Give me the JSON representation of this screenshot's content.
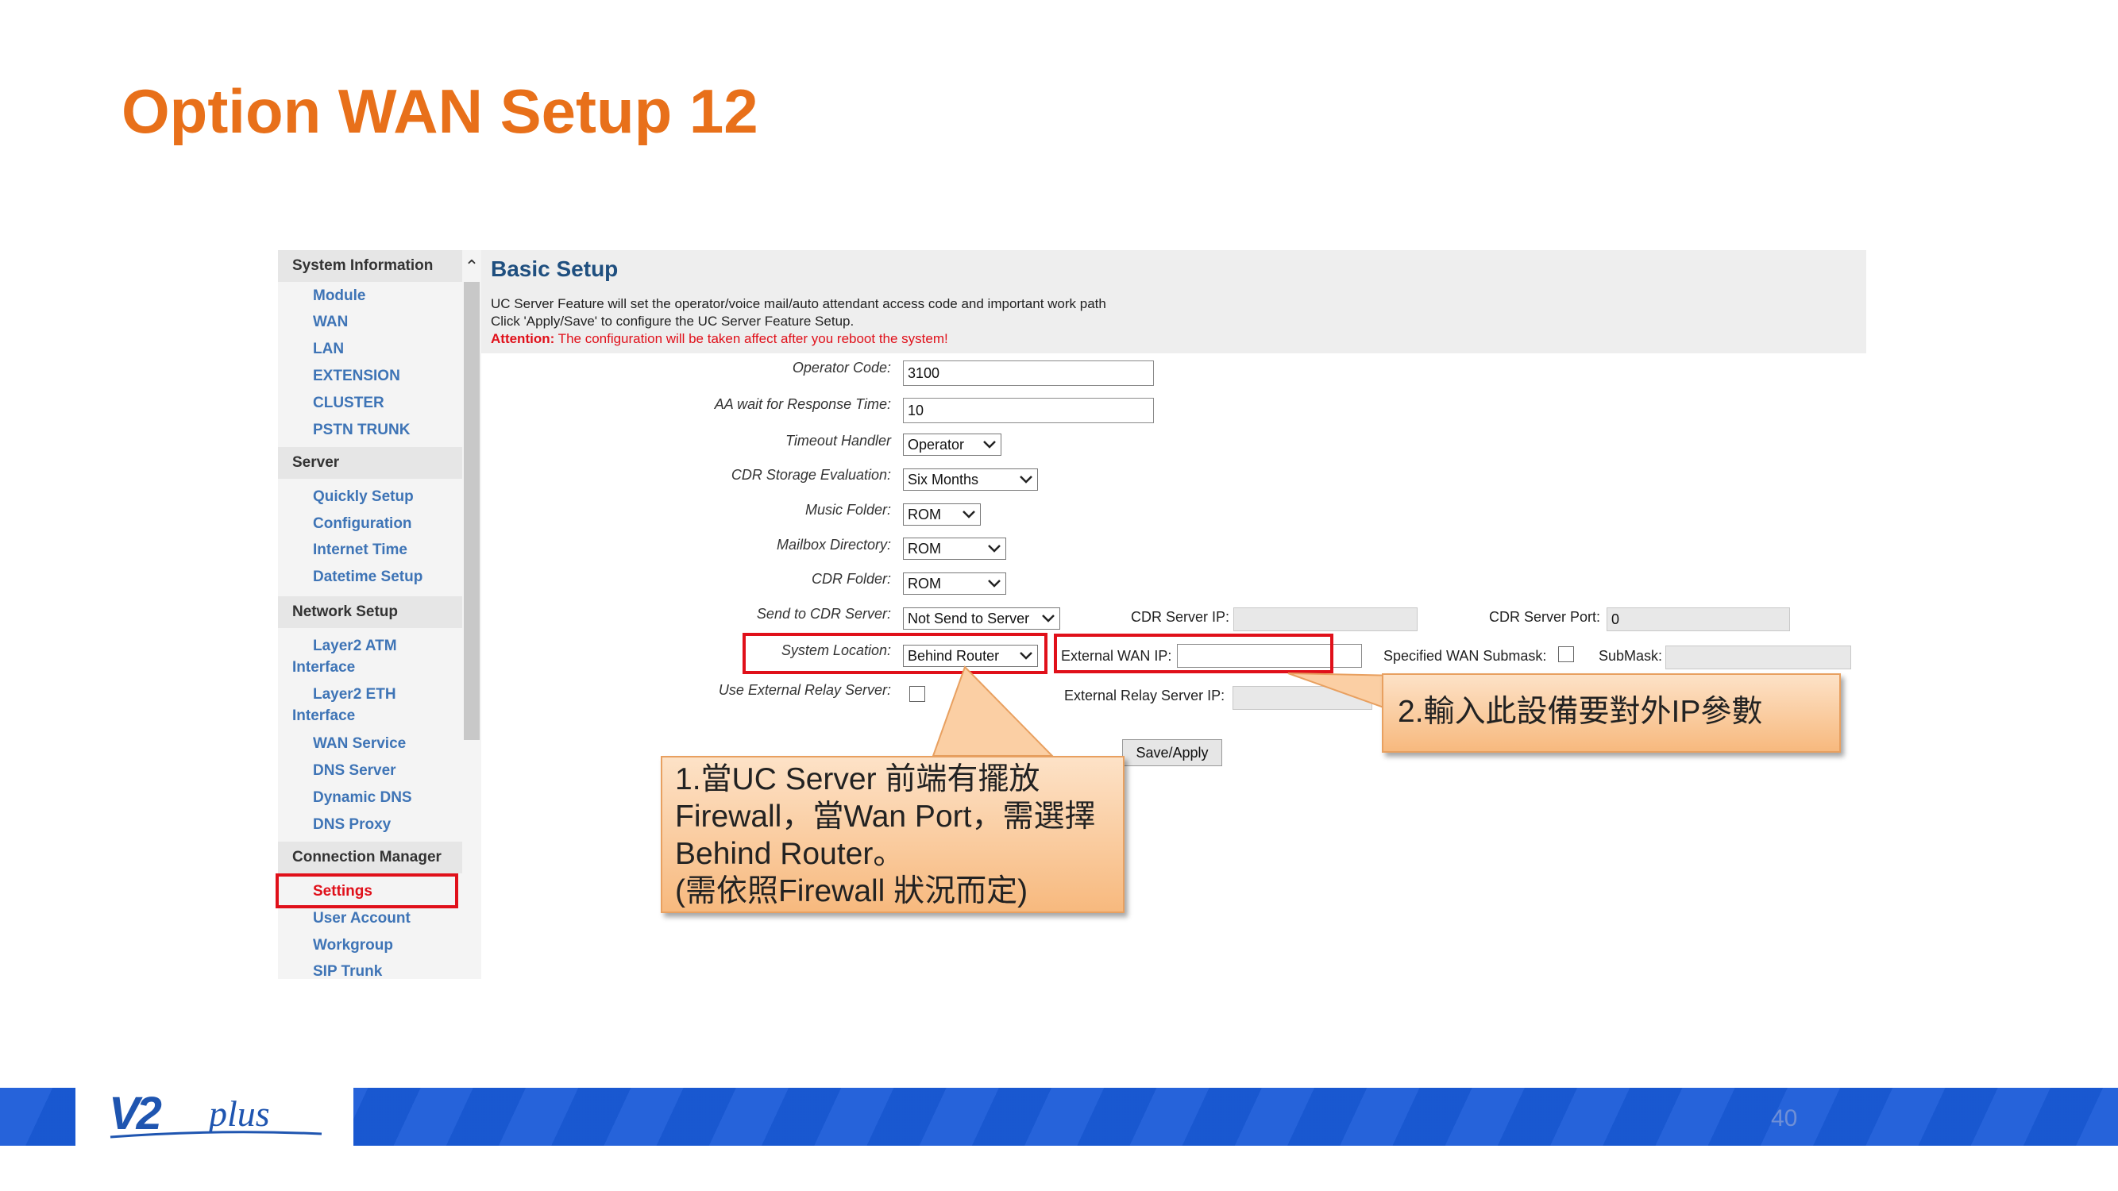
{
  "slide": {
    "title": "Option WAN Setup 12",
    "page_number": "40",
    "logo_text": "V2plus"
  },
  "sidebar": {
    "sections": [
      {
        "heading": "System Information",
        "items": [
          "Module",
          "WAN",
          "LAN",
          "EXTENSION",
          "CLUSTER",
          "PSTN TRUNK"
        ]
      },
      {
        "heading": "Server",
        "items": [
          "Quickly Setup",
          "Configuration",
          "Internet Time",
          "Datetime Setup"
        ]
      },
      {
        "heading": "Network Setup",
        "items": [
          "Layer2 ATM Interface",
          "Layer2 ETH Interface",
          "WAN Service",
          "DNS Server",
          "Dynamic DNS",
          "DNS Proxy"
        ]
      },
      {
        "heading": "Connection Manager",
        "items": [
          "Settings",
          "User Account",
          "Workgroup",
          "SIP Trunk"
        ]
      }
    ]
  },
  "main": {
    "title": "Basic Setup",
    "desc_line1": "UC Server Feature will set the operator/voice mail/auto attendant access code and important work path",
    "desc_line2": "Click 'Apply/Save' to configure the UC Server Feature Setup.",
    "attention_label": "Attention:",
    "attention_text": " The configuration will be taken affect after you reboot the system!",
    "fields": {
      "operator_code": {
        "label": "Operator Code:",
        "value": "3100"
      },
      "aa_wait": {
        "label": "AA wait for Response Time:",
        "value": "10"
      },
      "timeout_handler": {
        "label": "Timeout Handler",
        "value": "Operator"
      },
      "cdr_storage": {
        "label": "CDR Storage Evaluation:",
        "value": "Six Months"
      },
      "music_folder": {
        "label": "Music Folder:",
        "value": "ROM"
      },
      "mailbox_directory": {
        "label": "Mailbox Directory:",
        "value": "ROM"
      },
      "cdr_folder": {
        "label": "CDR Folder:",
        "value": "ROM"
      },
      "send_to_cdr": {
        "label": "Send to CDR Server:",
        "value": "Not Send to Server"
      },
      "cdr_server_ip": {
        "label": "CDR Server IP:",
        "value": ""
      },
      "cdr_server_port": {
        "label": "CDR Server Port:",
        "value": "0"
      },
      "system_location": {
        "label": "System Location:",
        "value": "Behind Router"
      },
      "external_wan_ip": {
        "label": "External WAN IP:",
        "value": ""
      },
      "specified_wan_submask": {
        "label": "Specified WAN Submask:"
      },
      "submask": {
        "label": "SubMask:",
        "value": ""
      },
      "use_external_relay": {
        "label": "Use External Relay Server:"
      },
      "external_relay_ip": {
        "label": "External Relay Server IP:",
        "value": ""
      }
    },
    "save_apply_label": "Save/Apply"
  },
  "callouts": {
    "c1_line1": "1.當UC Server 前端有擺放",
    "c1_line2": "Firewall，當Wan Port，需選擇",
    "c1_line3": "Behind Router。",
    "c1_line4": "(需依照Firewall 狀況而定)",
    "c2": "2.輸入此設備要對外IP參數"
  },
  "colors": {
    "title_orange": "#e8701a",
    "sidebar_link": "#3e74b6",
    "highlight_red": "#e0101a",
    "footer_blue": "#1a5bd8"
  }
}
